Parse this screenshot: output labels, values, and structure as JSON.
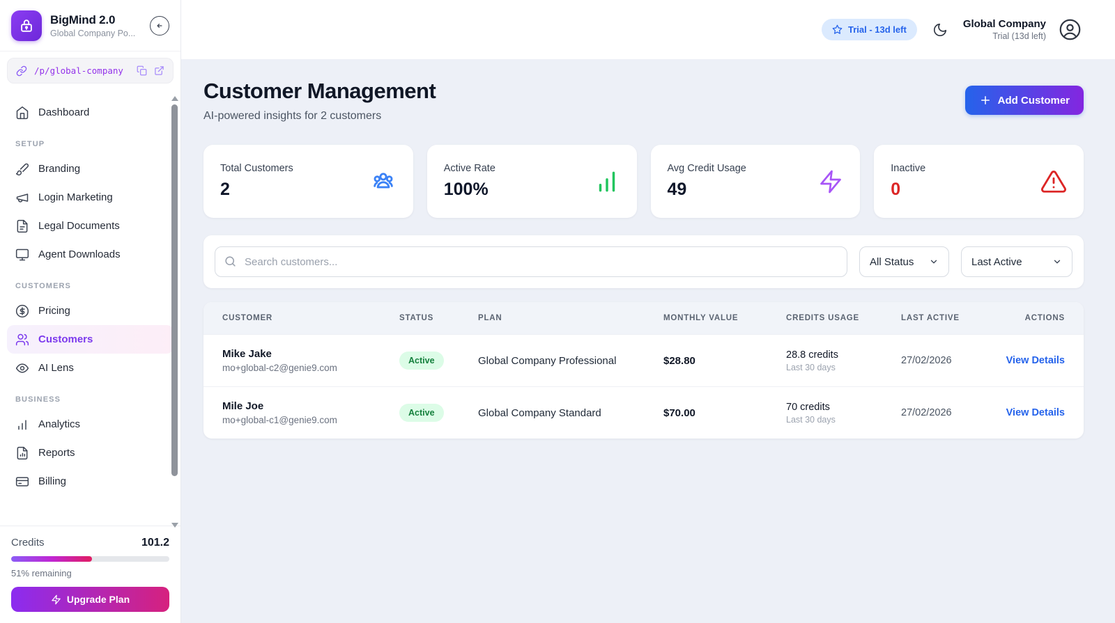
{
  "app": {
    "name": "BigMind 2.0",
    "workspace": "Global Company Po...",
    "portal_path": "/p/global-company"
  },
  "header": {
    "trial_badge": "Trial - 13d left",
    "account_name": "Global Company",
    "account_plan": "Trial (13d left)"
  },
  "sidebar": {
    "dashboard": "Dashboard",
    "sections": [
      {
        "title": "SETUP",
        "items": [
          "Branding",
          "Login Marketing",
          "Legal Documents",
          "Agent Downloads"
        ]
      },
      {
        "title": "CUSTOMERS",
        "items": [
          "Pricing",
          "Customers",
          "AI Lens"
        ]
      },
      {
        "title": "BUSINESS",
        "items": [
          "Analytics",
          "Reports",
          "Billing"
        ]
      }
    ],
    "active_item": "Customers",
    "credits": {
      "label": "Credits",
      "value": "101.2",
      "remaining": "51% remaining",
      "percent_used": 51,
      "bar_style": "width:51%",
      "upgrade_label": "Upgrade Plan"
    }
  },
  "main": {
    "title": "Customer Management",
    "subtitle": "AI-powered insights for 2 customers",
    "add_customer_label": "Add Customer",
    "stats": [
      {
        "label": "Total Customers",
        "value": "2",
        "icon": "users-icon",
        "accent": "#3b82f6"
      },
      {
        "label": "Active Rate",
        "value": "100%",
        "icon": "bar-chart-icon",
        "accent": "#22c55e"
      },
      {
        "label": "Avg Credit Usage",
        "value": "49",
        "icon": "lightning-icon",
        "accent": "#a855f7"
      },
      {
        "label": "Inactive",
        "value": "0",
        "icon": "alert-triangle-icon",
        "accent": "#dc2626"
      }
    ],
    "search": {
      "placeholder": "Search customers..."
    },
    "filters": {
      "status": "All Status",
      "sort": "Last Active"
    },
    "table": {
      "columns": [
        "Customer",
        "Status",
        "Plan",
        "Monthly Value",
        "Credits Usage",
        "Last Active",
        "Actions"
      ],
      "rows": [
        {
          "name": "Mike Jake",
          "email": "mo+global-c2@genie9.com",
          "status": "Active",
          "plan": "Global Company Professional",
          "monthly_value": "$28.80",
          "credits_used": "28.8 credits",
          "credits_period": "Last 30 days",
          "last_active": "27/02/2026",
          "action": "View Details"
        },
        {
          "name": "Mile Joe",
          "email": "mo+global-c1@genie9.com",
          "status": "Active",
          "plan": "Global Company Standard",
          "monthly_value": "$70.00",
          "credits_used": "70 credits",
          "credits_period": "Last 30 days",
          "last_active": "27/02/2026",
          "action": "View Details"
        }
      ]
    }
  },
  "colors": {
    "accent_purple": "#7c3aed",
    "accent_blue": "#2563eb",
    "accent_pink": "#db2777",
    "success_bg": "#dcfce7",
    "success_text": "#15803d",
    "danger": "#dc2626",
    "trial_badge_bg": "#dbeafe",
    "page_bg": "#edf0f7"
  }
}
